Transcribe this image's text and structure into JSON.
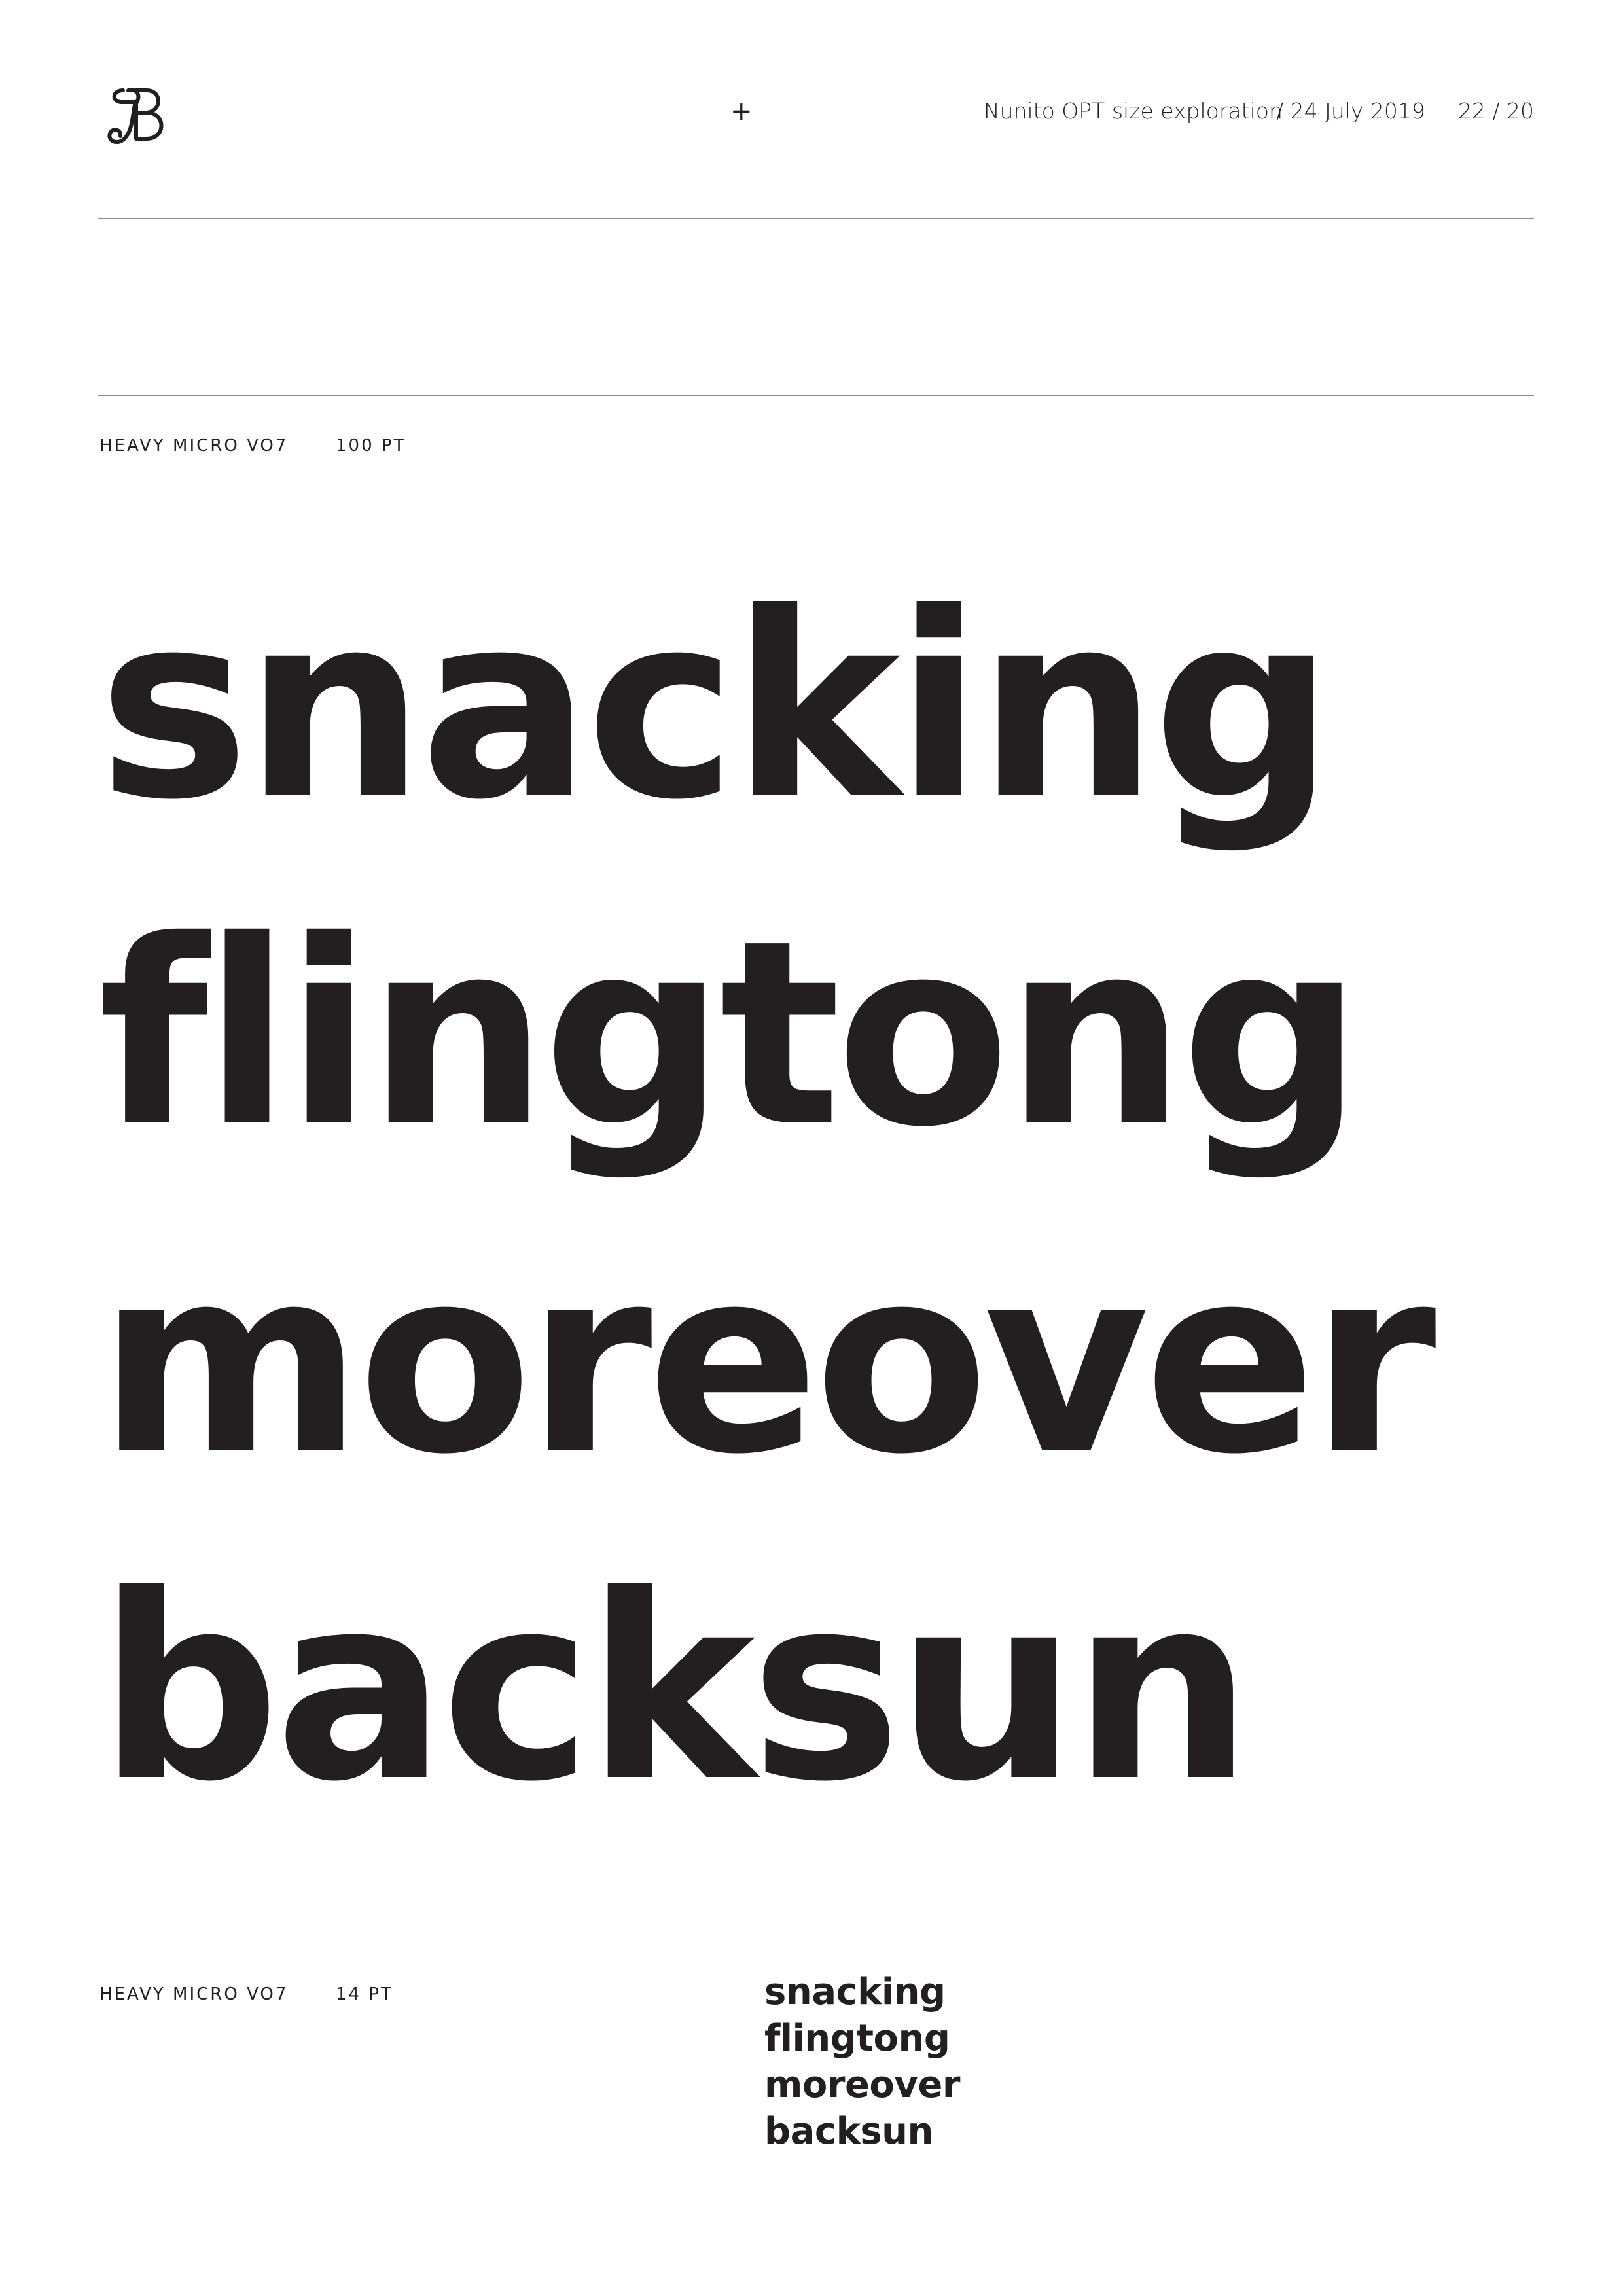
{
  "header": {
    "logo_icon": "jb-monogram-icon",
    "cross_glyph": "+",
    "title": "Nunito OPT size exploration",
    "date": "/ 24 July 2019",
    "page": "22 / 20"
  },
  "large_sample": {
    "style_label": "HEAVY MICRO VO7",
    "size_label": "100 PT",
    "lines": [
      "snacking",
      "flingtong",
      "moreover",
      "backsun"
    ]
  },
  "small_sample": {
    "style_label": "HEAVY MICRO VO7",
    "size_label": "14 PT",
    "lines": [
      "snacking",
      "flingtong",
      "moreover",
      "backsun"
    ]
  },
  "colors": {
    "ink": "#231f20",
    "rule": "#8a8a8a",
    "background": "#ffffff"
  }
}
